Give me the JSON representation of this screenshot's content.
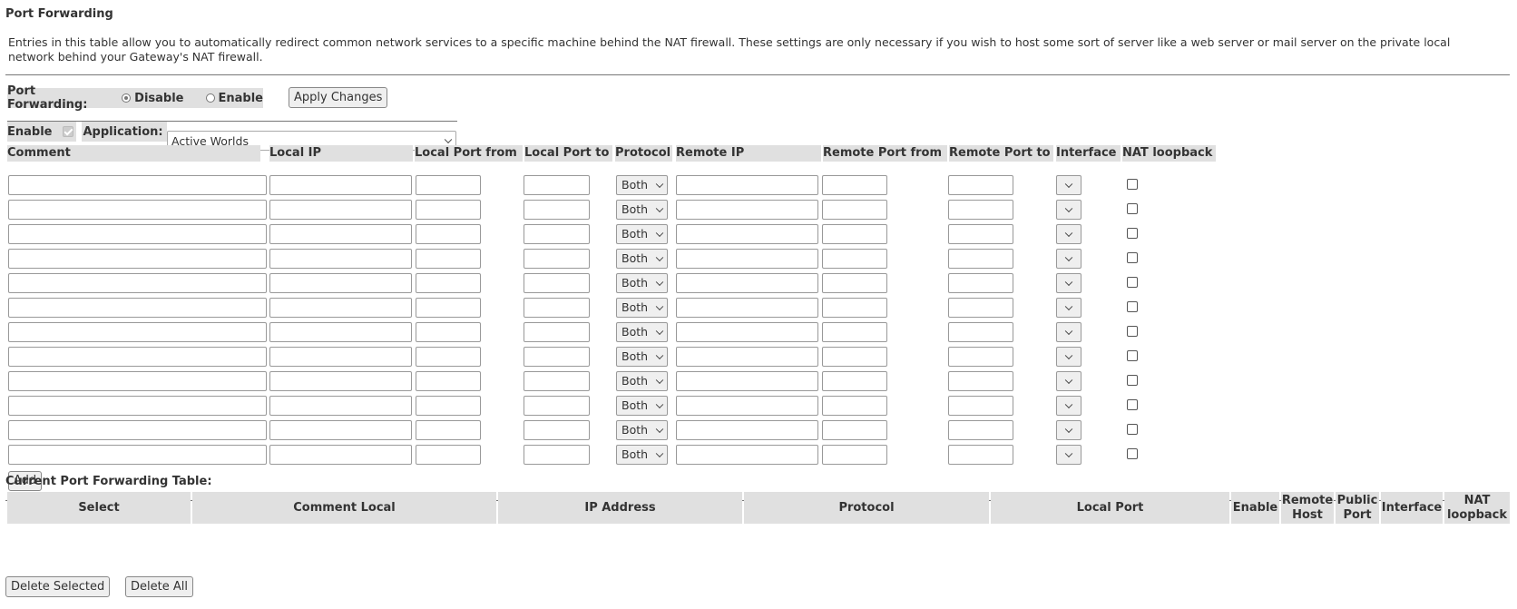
{
  "title": "Port Forwarding",
  "intro": "Entries in this table allow you to automatically redirect common network services to a specific machine behind the NAT firewall. These settings are only necessary if you wish to host some sort of server like a web server or mail server on the private local network behind your Gateway's NAT firewall.",
  "port_forwarding": {
    "label": "Port Forwarding:",
    "disable_label": "Disable",
    "enable_label": "Enable",
    "selected": "Disable",
    "apply_label": "Apply Changes"
  },
  "app_row": {
    "enable_label": "Enable",
    "enable_checked": true,
    "application_label": "Application:",
    "application_value": "Active Worlds"
  },
  "columns": [
    "Comment",
    "Local IP",
    "Local Port from",
    "Local Port to",
    "Protocol",
    "Remote IP",
    "Remote Port from",
    "Remote Port to",
    "Interface",
    "NAT loopback"
  ],
  "row_count": 12,
  "protocol_default": "Both",
  "add_label": "Add",
  "current_table": {
    "title": "Current Port Forwarding Table:",
    "headers": [
      "Select",
      "Comment Local",
      "IP Address",
      "Protocol",
      "Local Port",
      "Enable",
      "Remote Host",
      "Public Port",
      "Interface",
      "NAT loopback"
    ]
  },
  "delete_selected_label": "Delete Selected",
  "delete_all_label": "Delete All"
}
